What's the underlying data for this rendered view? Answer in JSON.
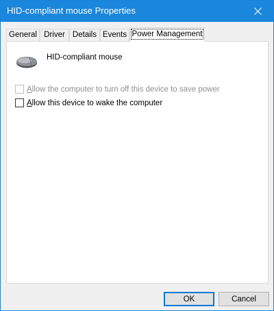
{
  "window": {
    "title": "HID-compliant mouse Properties",
    "accent": "#1a86dc"
  },
  "tabs": [
    {
      "label": "General"
    },
    {
      "label": "Driver"
    },
    {
      "label": "Details"
    },
    {
      "label": "Events"
    },
    {
      "label": "Power Management",
      "active": true
    }
  ],
  "device": {
    "name": "HID-compliant mouse",
    "icon": "mouse-icon"
  },
  "options": [
    {
      "prefix": "",
      "accel": "A",
      "rest": "llow the computer to turn off this device to save power",
      "checked": false,
      "enabled": false
    },
    {
      "prefix": "",
      "accel": "A",
      "rest": "llow this device to wake the computer",
      "checked": false,
      "enabled": true
    }
  ],
  "buttons": {
    "ok": "OK",
    "cancel": "Cancel"
  }
}
